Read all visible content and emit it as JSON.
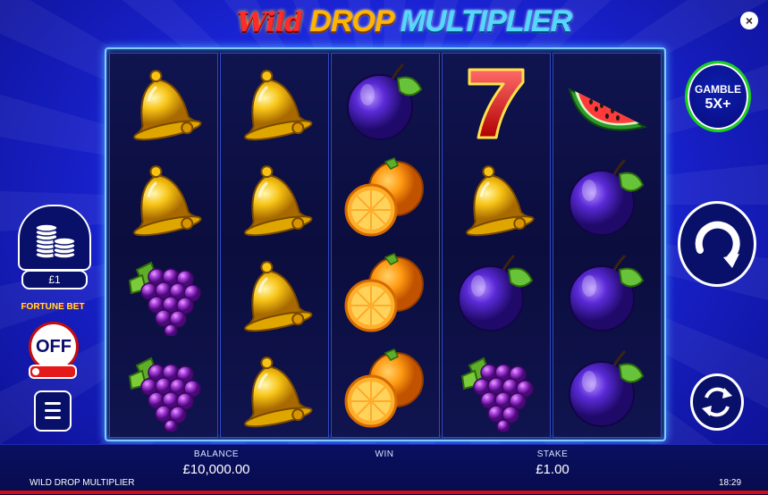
{
  "game": {
    "title_wild": "Wild",
    "title_drop": "DROP",
    "title_multiplier": "MULTIPLIER"
  },
  "close": {
    "label": "×"
  },
  "reels": [
    [
      "bell",
      "bell",
      "grapes",
      "grapes"
    ],
    [
      "bell",
      "bell",
      "bell",
      "bell"
    ],
    [
      "plum",
      "orange",
      "orange",
      "orange"
    ],
    [
      "seven",
      "bell",
      "plum",
      "grapes"
    ],
    [
      "watermelon",
      "plum",
      "plum",
      "plum"
    ]
  ],
  "left_panel": {
    "coin_icon": "coin-stack-icon",
    "coin_value": "£1",
    "fortune_bet_label": "FORTUNE BET",
    "fortune_bet_state": "OFF",
    "menu_icon": "hamburger-menu-icon"
  },
  "right_panel": {
    "gamble_line1": "GAMBLE",
    "gamble_line2": "5X+",
    "spin_icon": "spin-arrow-icon",
    "autoplay_icon": "autoplay-icon"
  },
  "bottom_bar": {
    "balance_label": "BALANCE",
    "balance_value": "£10,000.00",
    "win_label": "WIN",
    "win_value": "",
    "stake_label": "STAKE",
    "stake_value": "£1.00"
  },
  "footer": {
    "game_name": "WILD DROP MULTIPLIER",
    "time": "18:29"
  },
  "colors": {
    "background": "#1a24d6",
    "reel_border": "#7ecbff",
    "gamble_ring": "#18d11f",
    "fortune_red": "#e41a1a"
  }
}
